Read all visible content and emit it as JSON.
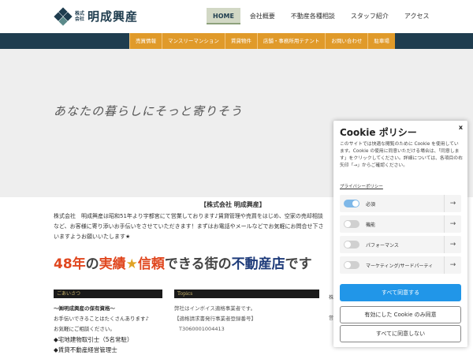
{
  "header": {
    "logo_small": "株式会社",
    "logo_text": "明成興産",
    "nav": [
      "HOME",
      "会社概要",
      "不動産各種相談",
      "スタッフ紹介",
      "アクセス"
    ]
  },
  "subnav": [
    "売買情報",
    "マンスリーマンション",
    "賃貸物件",
    "店舗・事務所用テナント",
    "お問い合わせ",
    "駐車場"
  ],
  "hero": {
    "text": "あなたの暮らしにそっと寄りそう"
  },
  "main": {
    "company": "【株式会社 明成興産】",
    "intro": "株式会社　明成興産は昭和51年より宇都宮にて営業しております♪賃貸管理や売買をはじめ、空家の売却相談など、お客様に寄り添いお手伝いをさせていただきます！まずはお電話やメールなどでお気軽にお問合せ下さいますようお願いいたします★",
    "slogan": {
      "p1": "48年",
      "p2": "の",
      "p3": "実績",
      "p4": "★",
      "p5": "信頼",
      "p6": "できる街の",
      "p7": "不動産店",
      "p8": "です"
    }
  },
  "left_col": {
    "heading": "ごあいさつ",
    "title": "～㈱明成興産の保有資格～",
    "line1": "お手伝いできることはたくさんあります♪",
    "line2": "お気軽にご相談ください。",
    "item1": "◆宅地建物取引士（5名常駐）",
    "item2": "◆賃貸不動産経営管理士"
  },
  "mid_col": {
    "heading": "Topics",
    "line1": "弊社はインボイス適格事業者です。",
    "line2": "【適格請求書発行事業者登録番号】",
    "line3": "T3060001004413"
  },
  "right_frags": [
    "株",
    "営"
  ],
  "cookie": {
    "title": "Cookie ポリシー",
    "close": "x",
    "description": "このサイトでは快適な閲覧のために Cookie を使用しています。Cookie の使用に同意いただける場合は、「同意します」をクリックしてください。詳細については、各項目の右矢印「→」からご確認ください。",
    "policy_link": "プライバシーポリシー",
    "rows": [
      {
        "label": "必須",
        "on": true
      },
      {
        "label": "機能",
        "on": false
      },
      {
        "label": "パフォーマンス",
        "on": false
      },
      {
        "label": "マーケティング/サードパーティ",
        "on": false
      }
    ],
    "accept_all": "すべて同意する",
    "accept_enabled": "有効にした Cookie のみ同意",
    "reject_all": "すべてに同意しない",
    "arrow": "→"
  },
  "colors": {
    "navy": "#1f3d4f",
    "orange": "#e09a2a",
    "accent_blue": "#2196e8",
    "slogan_red": "#e0471f"
  }
}
